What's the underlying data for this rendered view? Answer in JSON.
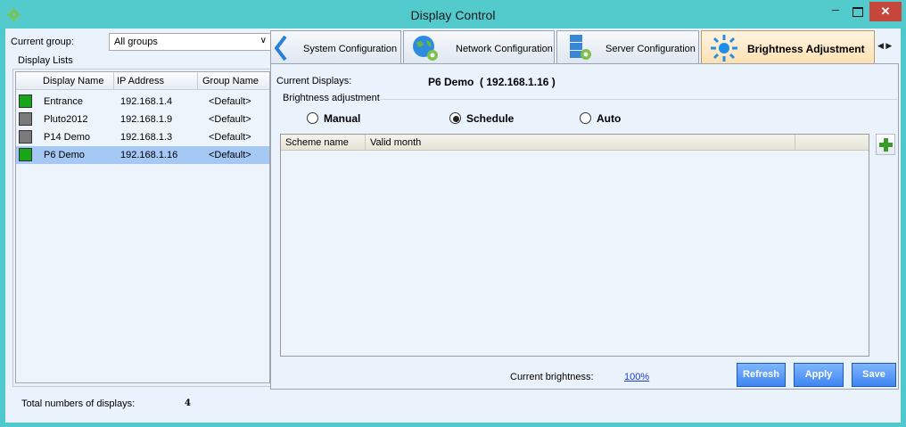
{
  "window": {
    "title": "Display Control",
    "minimize_glyph": "–",
    "close_glyph": "✕"
  },
  "left": {
    "current_group_label": "Current group:",
    "current_group_value": "All groups",
    "display_lists_label": "Display Lists",
    "columns": [
      "Display Name",
      "IP Address",
      "Group Name"
    ],
    "rows": [
      {
        "name": "Entrance",
        "ip": "192.168.1.4",
        "group": "<Default>",
        "color": "#17a61a"
      },
      {
        "name": "Pluto2012",
        "ip": "192.168.1.9",
        "group": "<Default>",
        "color": "#7a7a7a"
      },
      {
        "name": "P14 Demo",
        "ip": "192.168.1.3",
        "group": "<Default>",
        "color": "#7a7a7a"
      },
      {
        "name": "P6 Demo",
        "ip": "192.168.1.16",
        "group": "<Default>",
        "color": "#17a61a"
      }
    ],
    "selected_row": 3,
    "total_label": "Total numbers of displays:",
    "total_value": "4"
  },
  "tabs": {
    "system": "System Configuration",
    "network": "Network Configuration",
    "server": "Server Configuration",
    "brightness": "Brightness Adjustment",
    "scroll_glyph": "◀ ▶",
    "active": "brightness"
  },
  "brightness": {
    "current_displays_label": "Current Displays:",
    "current_displays_value": "P6 Demo  ( 192.168.1.16 )",
    "group_label": "Brightness adjustment",
    "modes": [
      "Manual",
      "Schedule",
      "Auto"
    ],
    "selected_mode": "Schedule",
    "scheme_columns": [
      "Scheme name",
      "Valid month"
    ],
    "current_brightness_label": "Current brightness:",
    "current_brightness_value": "100%",
    "buttons": {
      "refresh": "Refresh",
      "apply": "Apply",
      "save": "Save"
    }
  },
  "colors": {
    "titlebar": "#53cbcd",
    "client_bg": "#eaf2fb",
    "selected_row": "#a5c8f5",
    "button_blue": "#3f86f0",
    "close": "#c7463c",
    "link": "#1f3fd0"
  },
  "icons": {
    "app": "gear-icon",
    "system_tab": "wrench-icon",
    "network_tab": "globe-icon",
    "server_tab": "server-icon",
    "brightness_tab": "sun-icon",
    "add": "plus-icon"
  }
}
